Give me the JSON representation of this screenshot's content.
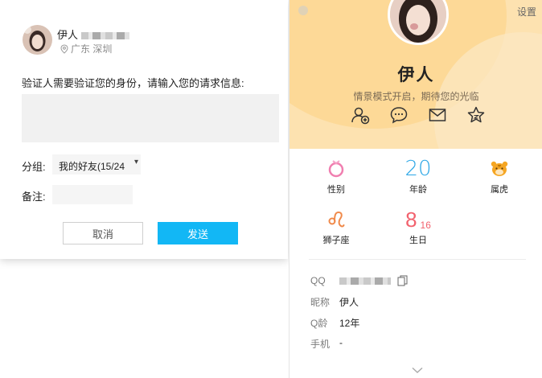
{
  "dialog": {
    "user": {
      "name": "伊人",
      "location": "广东 深圳"
    },
    "prompt": "验证人需要验证您的身份，请输入您的请求信息:",
    "request_message": "",
    "group_label": "分组:",
    "group_value": "我的好友(15/24",
    "remark_label": "备注:",
    "remark_value": "",
    "cancel_button": "取消",
    "send_button": "发送"
  },
  "panel": {
    "settings_label": "设置",
    "name": "伊人",
    "signature": "情景模式开启，期待您的光临",
    "actions": [
      "add-friend-icon",
      "chat-bubble-icon",
      "mail-icon",
      "star-icon"
    ],
    "info": {
      "gender_label": "性别",
      "age_value": "20",
      "age_label": "年龄",
      "zodiac_label": "属虎",
      "constellation_label": "狮子座",
      "birthday_month": "8",
      "birthday_day": "16",
      "birthday_label": "生日"
    },
    "fields": {
      "qq_label": "QQ",
      "nickname_label": "昵称",
      "nickname_value": "伊人",
      "qage_label": "Q龄",
      "qage_value": "12年",
      "phone_label": "手机",
      "phone_value": "-"
    },
    "colors": {
      "accent": "#12b7f5",
      "age": "#2aa6e6",
      "birthday": "#f2626e",
      "hero_bg": "#fde2b0"
    }
  }
}
